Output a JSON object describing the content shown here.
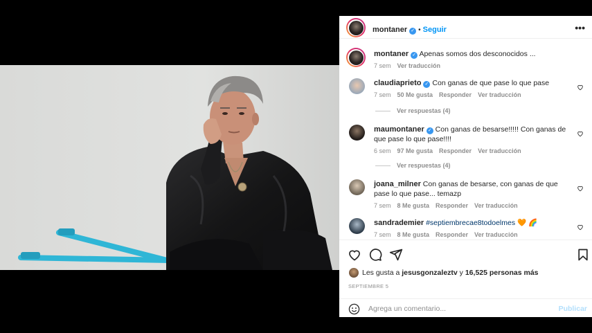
{
  "header": {
    "username": "montaner",
    "separator": "•",
    "follow_label": "Seguir",
    "more_label": "•••",
    "verified_glyph": "✓"
  },
  "caption": {
    "username": "montaner",
    "text": "Apenas somos dos desconocidos ...",
    "time": "7 sem",
    "translate": "Ver traducción"
  },
  "comments": [
    {
      "username": "claudiaprieto",
      "verified": true,
      "text": "Con ganas de que pase lo que pase",
      "time": "7 sem",
      "likes": "50 Me gusta",
      "reply": "Responder",
      "translate": "Ver traducción",
      "replies": "Ver respuestas (4)"
    },
    {
      "username": "maumontaner",
      "verified": true,
      "text": "Con ganas de besarse!!!!! Con ganas de que pase lo que pase!!!!",
      "time": "6 sem",
      "likes": "97 Me gusta",
      "reply": "Responder",
      "translate": "Ver traducción",
      "replies": "Ver respuestas (4)"
    },
    {
      "username": "joana_milner",
      "verified": false,
      "text": "Con ganas de besarse, con ganas de que pase lo que pase... temazp",
      "time": "7 sem",
      "likes": "8 Me gusta",
      "reply": "Responder",
      "translate": "Ver traducción"
    },
    {
      "username": "sandrademier",
      "verified": false,
      "hashtag": "#septiembrecae8todoelmes",
      "emoji": "🧡 🌈",
      "time": "7 sem",
      "likes": "8 Me gusta",
      "reply": "Responder",
      "translate": "Ver traducción"
    }
  ],
  "likes": {
    "prefix": "Les gusta a",
    "user": "jesusgonzaleztv",
    "middle": "y",
    "count": "16,525 personas más"
  },
  "date": "SEPTIEMBRE 5",
  "add_comment": {
    "placeholder": "Agrega un comentario...",
    "post_label": "Publicar"
  },
  "colors": {
    "accent": "#0095f6",
    "verified": "#3897f0",
    "muted": "#8e8e8e",
    "wheelbarrow": "#2fb6d6"
  }
}
